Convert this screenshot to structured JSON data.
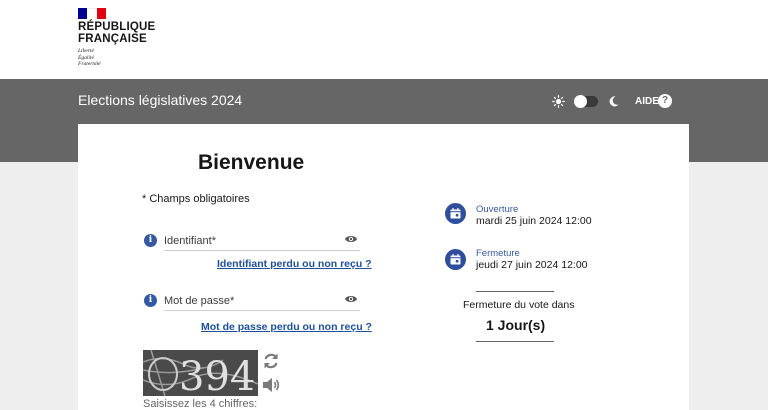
{
  "header": {
    "republic_line1": "RÉPUBLIQUE",
    "republic_line2": "FRANÇAISE",
    "motto": [
      "Liberté",
      "Égalité",
      "Fraternité"
    ],
    "flag_colors": [
      "#000091",
      "#ffffff",
      "#e1000f"
    ]
  },
  "band": {
    "title": "Elections législatives 2024",
    "theme_toggle_state": "light",
    "help_label": "AIDE",
    "help_symbol": "?"
  },
  "login": {
    "heading": "Bienvenue",
    "required_note": "* Champs obligatoires",
    "identifier_placeholder": "Identifiant*",
    "identifier_forgot": "Identifiant perdu ou non reçu ?",
    "password_placeholder": "Mot de passe*",
    "password_forgot": "Mot de passe perdu ou non reçu ?",
    "captcha_text": "394",
    "captcha_hint": "Saisissez les 4 chiffres:"
  },
  "schedule": {
    "opening_label": "Ouverture",
    "opening_value": "mardi 25 juin 2024 12:00",
    "closing_label": "Fermeture",
    "closing_value": "jeudi 27 juin 2024 12:00",
    "countdown_label": "Fermeture du vote dans",
    "countdown_value": "1 Jour(s)"
  },
  "colors": {
    "band": "#666666",
    "accent": "#3558a2",
    "link": "#1d4f9c"
  }
}
